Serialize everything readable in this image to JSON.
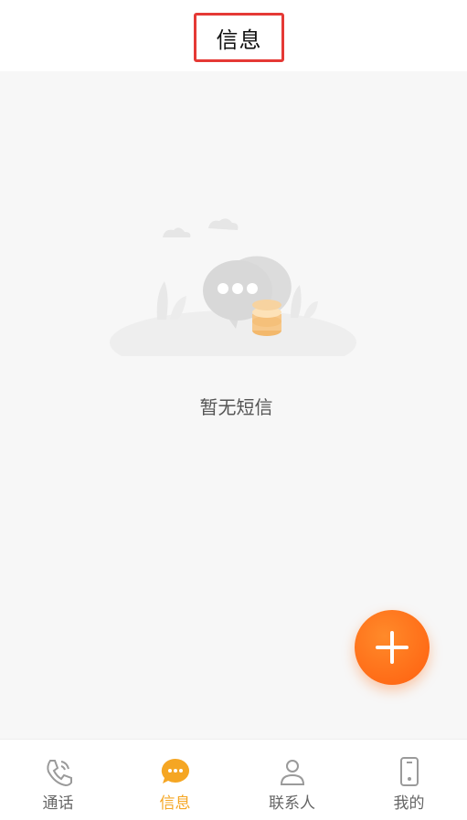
{
  "header": {
    "title": "信息"
  },
  "empty_state": {
    "message": "暂无短信",
    "illustration_icon": "chat-bubble-coins-illustration"
  },
  "fab": {
    "icon": "plus-icon",
    "color": "#ff6a14"
  },
  "tabs": [
    {
      "label": "通话",
      "icon": "phone-icon",
      "active": false
    },
    {
      "label": "信息",
      "icon": "message-icon",
      "active": true
    },
    {
      "label": "联系人",
      "icon": "person-icon",
      "active": false
    },
    {
      "label": "我的",
      "icon": "mobile-icon",
      "active": false
    }
  ],
  "colors": {
    "accent": "#f5a623",
    "inactive": "#666666",
    "highlight_box": "#e53935"
  }
}
